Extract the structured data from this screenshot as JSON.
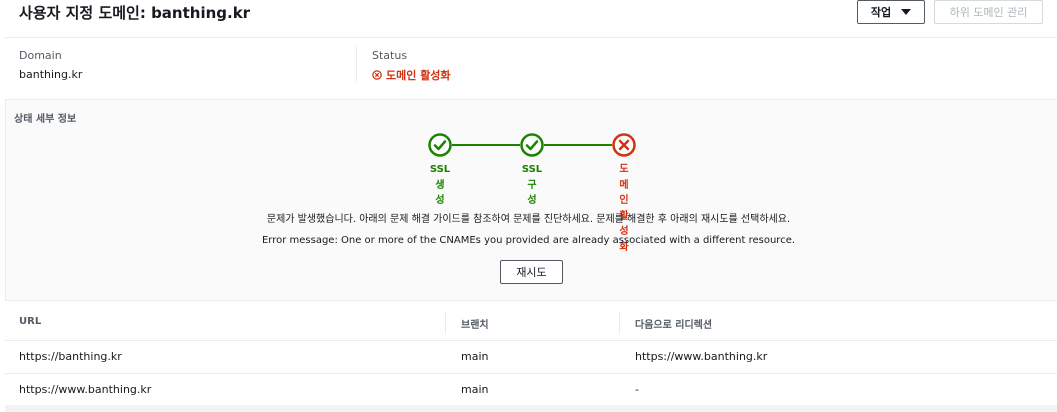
{
  "header": {
    "title": "사용자 지정 도메인: banthing.kr",
    "actions_label": "작업",
    "manage_subdomains_label": "하위 도메인 관리"
  },
  "summary": {
    "domain_label": "Domain",
    "domain_value": "banthing.kr",
    "status_label": "Status",
    "status_value": "도메인 활성화"
  },
  "details": {
    "section_title": "상태 세부 정보",
    "steps": [
      {
        "label": "SSL\n생\n성",
        "state": "success"
      },
      {
        "label": "SSL\n구\n성",
        "state": "success"
      },
      {
        "label": "도\n메\n인\n활\n성\n화",
        "state": "error"
      }
    ],
    "message": "문제가 발생했습니다. 아래의 문제 해결 가이드를 참조하여 문제를 진단하세요. 문제를 해결한 후 아래의 재시도를 선택하세요.",
    "error_message": "Error message: One or more of the CNAMEs you provided are already associated with a different resource.",
    "retry_label": "재시도"
  },
  "table": {
    "headers": [
      "URL",
      "브랜치",
      "다음으로 리디렉션"
    ],
    "rows": [
      [
        "https://banthing.kr",
        "main",
        "https://www.banthing.kr"
      ],
      [
        "https://www.banthing.kr",
        "main",
        "-"
      ]
    ]
  },
  "colors": {
    "success": "#1d8102",
    "error": "#d13212"
  }
}
